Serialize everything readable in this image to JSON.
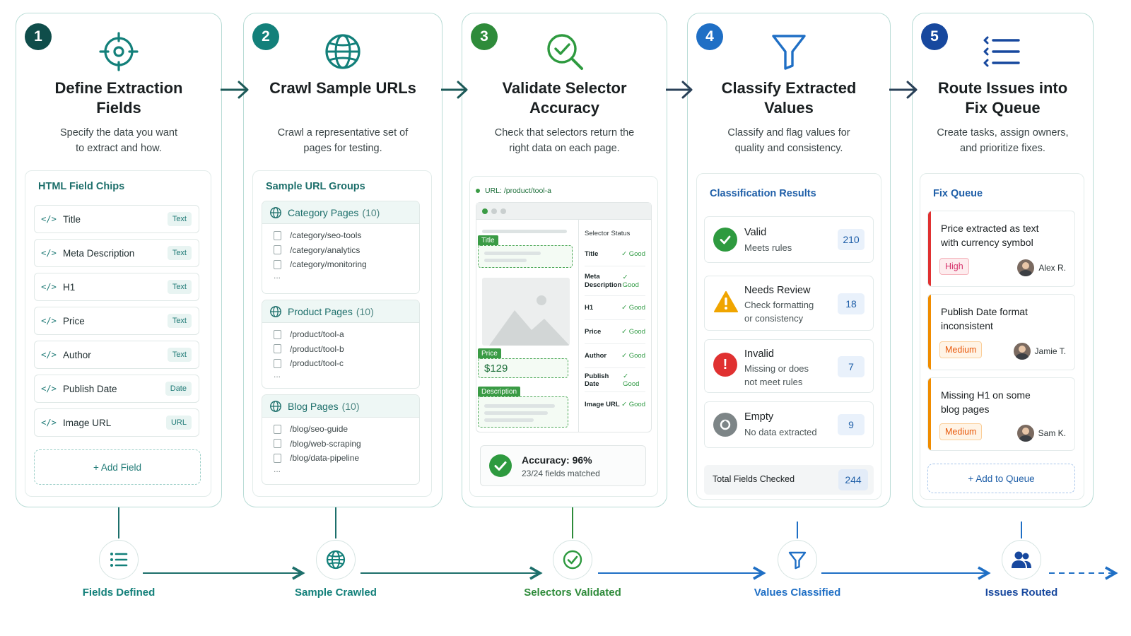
{
  "steps": [
    {
      "number": "1",
      "title_line1": "Define Extraction",
      "title_line2": "Fields",
      "desc_line1": "Specify the data you want",
      "desc_line2": "to extract and how.",
      "icon": "target-icon",
      "color": "#0f4d4a"
    },
    {
      "number": "2",
      "title_line1": "Crawl Sample URLs",
      "title_line2": "",
      "desc_line1": "Crawl a representative set of",
      "desc_line2": "pages for testing.",
      "icon": "globe-icon",
      "color": "#13807a"
    },
    {
      "number": "3",
      "title_line1": "Validate Selector",
      "title_line2": "Accuracy",
      "desc_line1": "Check that selectors return the",
      "desc_line2": "right data on each page.",
      "icon": "magnifier-check-icon",
      "color": "#2e8b3a"
    },
    {
      "number": "4",
      "title_line1": "Classify Extracted",
      "title_line2": "Values",
      "desc_line1": "Classify and flag values for",
      "desc_line2": "quality and consistency.",
      "icon": "funnel-icon",
      "color": "#1f6fc5"
    },
    {
      "number": "5",
      "title_line1": "Route Issues into",
      "title_line2": "Fix Queue",
      "desc_line1": "Create tasks, assign owners,",
      "desc_line2": "and prioritize fixes.",
      "icon": "list-icon",
      "color": "#17489e"
    }
  ],
  "fields_panel": {
    "title": "HTML Field Chips",
    "chips": [
      {
        "name": "Title",
        "type": "Text"
      },
      {
        "name": "Meta Description",
        "type": "Text"
      },
      {
        "name": "H1",
        "type": "Text"
      },
      {
        "name": "Price",
        "type": "Text"
      },
      {
        "name": "Author",
        "type": "Text"
      },
      {
        "name": "Publish Date",
        "type": "Date"
      },
      {
        "name": "Image URL",
        "type": "URL"
      }
    ],
    "add_label": "+ Add Field"
  },
  "url_panel": {
    "title": "Sample URL Groups",
    "groups": [
      {
        "name": "Category Pages",
        "count": "(10)",
        "urls": [
          "/category/seo-tools",
          "/category/analytics",
          "/category/monitoring"
        ]
      },
      {
        "name": "Product Pages",
        "count": "(10)",
        "urls": [
          "/product/tool-a",
          "/product/tool-b",
          "/product/tool-c"
        ]
      },
      {
        "name": "Blog Pages",
        "count": "(10)",
        "urls": [
          "/blog/seo-guide",
          "/blog/web-scraping",
          "/blog/data-pipeline"
        ]
      }
    ],
    "ellipsis": "..."
  },
  "validate_panel": {
    "url": "URL: /product/tool-a",
    "status_header": "Selector Status",
    "tags": {
      "title": "Title",
      "price": "Price",
      "description": "Description"
    },
    "price_value": "$129",
    "rows": [
      {
        "label": "Title",
        "status": "✓ Good"
      },
      {
        "label": "Meta Description",
        "status": "✓ Good"
      },
      {
        "label": "H1",
        "status": "✓ Good"
      },
      {
        "label": "Price",
        "status": "✓ Good"
      },
      {
        "label": "Author",
        "status": "✓ Good"
      },
      {
        "label": "Publish Date",
        "status": "✓ Good"
      },
      {
        "label": "Image URL",
        "status": "✓ Good"
      }
    ],
    "accuracy_title": "Accuracy: 96%",
    "accuracy_sub": "23/24 fields matched"
  },
  "classify_panel": {
    "title": "Classification Results",
    "results": [
      {
        "title": "Valid",
        "sub1": "Meets rules",
        "sub2": "",
        "count": "210",
        "icon": "check-circle-icon",
        "color": "#2e9a3f"
      },
      {
        "title": "Needs Review",
        "sub1": "Check formatting",
        "sub2": "or consistency",
        "count": "18",
        "icon": "warning-icon",
        "color": "#f0a500"
      },
      {
        "title": "Invalid",
        "sub1": "Missing or does",
        "sub2": "not meet rules",
        "count": "7",
        "icon": "error-icon",
        "color": "#e03131"
      },
      {
        "title": "Empty",
        "sub1": "No data extracted",
        "sub2": "",
        "count": "9",
        "icon": "empty-icon",
        "color": "#7d8587"
      }
    ],
    "total_label": "Total Fields Checked",
    "total_value": "244"
  },
  "queue_panel": {
    "title": "Fix Queue",
    "issues": [
      {
        "line1": "Price extracted as text",
        "line2": "with currency symbol",
        "priority": "High",
        "owner": "Alex R.",
        "color": "#e03131"
      },
      {
        "line1": "Publish Date format",
        "line2": "inconsistent",
        "priority": "Medium",
        "owner": "Jamie T.",
        "color": "#f08c00"
      },
      {
        "line1": "Missing H1 on some",
        "line2": "blog pages",
        "priority": "Medium",
        "owner": "Sam K.",
        "color": "#f08c00"
      }
    ],
    "add_label": "+ Add to Queue"
  },
  "milestones": [
    {
      "label": "Fields Defined",
      "icon": "list-icon",
      "color": "#13807a"
    },
    {
      "label": "Sample Crawled",
      "icon": "globe-icon",
      "color": "#13807a"
    },
    {
      "label": "Selectors Validated",
      "icon": "check-circle-icon",
      "color": "#2e8b3a"
    },
    {
      "label": "Values Classified",
      "icon": "funnel-icon",
      "color": "#1f6fc5"
    },
    {
      "label": "Issues Routed",
      "icon": "users-icon",
      "color": "#17489e"
    }
  ]
}
